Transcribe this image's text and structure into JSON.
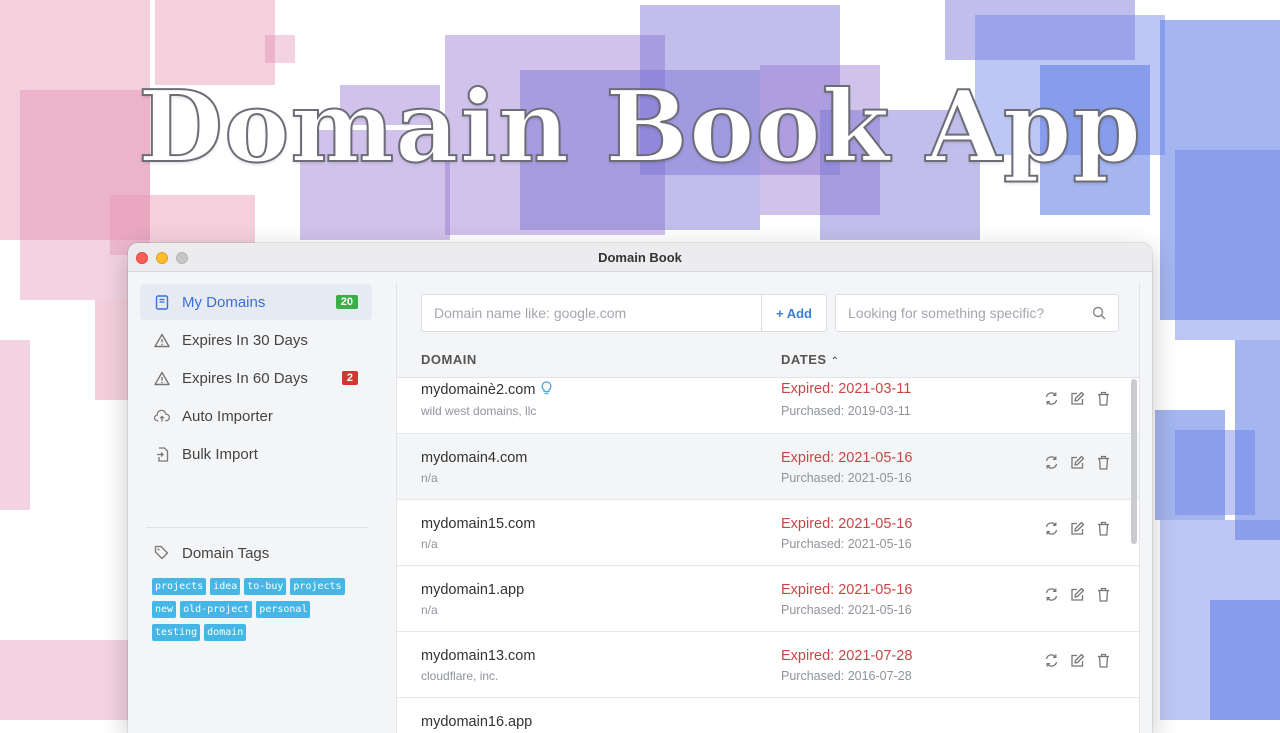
{
  "hero": {
    "title": "Domain Book App"
  },
  "window": {
    "title": "Domain Book"
  },
  "sidebar": {
    "items": [
      {
        "label": "My Domains",
        "icon": "book-icon",
        "badge": "20",
        "badge_color": "#3cae46",
        "active": true
      },
      {
        "label": "Expires In 30 Days",
        "icon": "warning-icon"
      },
      {
        "label": "Expires In 60 Days",
        "icon": "warning-icon",
        "badge": "2",
        "badge_color": "#d63333"
      },
      {
        "label": "Auto Importer",
        "icon": "cloud-upload-icon"
      },
      {
        "label": "Bulk Import",
        "icon": "file-import-icon"
      }
    ],
    "tags_heading": "Domain Tags",
    "tags": [
      "projects",
      "idea",
      "to-buy",
      "projects",
      "new",
      "old-project",
      "personal",
      "testing",
      "domain"
    ]
  },
  "toolbar": {
    "add_placeholder": "Domain name like: google.com",
    "add_label": "+ Add",
    "search_placeholder": "Looking for something specific?"
  },
  "table": {
    "columns": {
      "domain": "DOMAIN",
      "dates": "DATES"
    },
    "rows": [
      {
        "domain": "mydomainè2.com",
        "registrar": "wild west domains, llc",
        "expired": "Expired: 2021-03-11",
        "purchased": "Purchased: 2019-03-11"
      },
      {
        "domain": "mydomain4.com",
        "registrar": "n/a",
        "expired": "Expired: 2021-05-16",
        "purchased": "Purchased: 2021-05-16"
      },
      {
        "domain": "mydomain15.com",
        "registrar": "n/a",
        "expired": "Expired: 2021-05-16",
        "purchased": "Purchased: 2021-05-16"
      },
      {
        "domain": "mydomain1.app",
        "registrar": "n/a",
        "expired": "Expired: 2021-05-16",
        "purchased": "Purchased: 2021-05-16"
      },
      {
        "domain": "mydomain13.com",
        "registrar": "cloudflare, inc.",
        "expired": "Expired: 2021-07-28",
        "purchased": "Purchased: 2016-07-28"
      },
      {
        "domain": "mydomain16.app",
        "registrar": "",
        "expired": "",
        "purchased": ""
      }
    ]
  },
  "colors": {
    "accent": "#3a6fd8",
    "expired": "#c94545",
    "tag": "#45b6e6"
  }
}
